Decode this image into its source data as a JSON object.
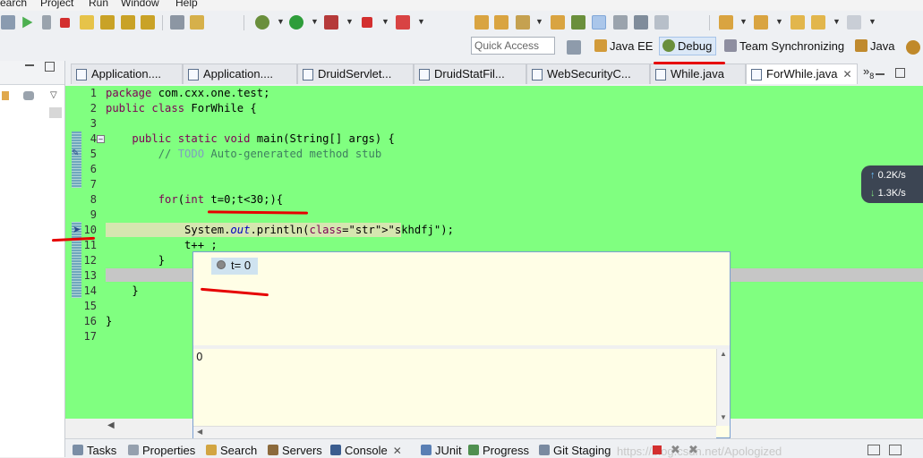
{
  "menu": [
    "earch",
    "Project",
    "Run",
    "Window",
    "Help"
  ],
  "quick_access": {
    "placeholder": "Quick Access"
  },
  "perspectives": [
    {
      "label": "Java EE",
      "active": false
    },
    {
      "label": "Debug",
      "active": true
    },
    {
      "label": "Team Synchronizing",
      "active": false
    },
    {
      "label": "Java",
      "active": false
    }
  ],
  "editor_tabs": [
    {
      "label": "Application....",
      "active": false
    },
    {
      "label": "Application....",
      "active": false
    },
    {
      "label": "DruidServlet...",
      "active": false
    },
    {
      "label": "DruidStatFil...",
      "active": false
    },
    {
      "label": "WebSecurityC...",
      "active": false
    },
    {
      "label": "While.java",
      "active": false
    },
    {
      "label": "ForWhile.java",
      "active": true
    }
  ],
  "tab_overflow": {
    "symbol": "»",
    "count": "8"
  },
  "close_symbol": "✕",
  "code_lines": [
    {
      "n": "1",
      "text": "package com.cxx.one.test;"
    },
    {
      "n": "2",
      "text": "public class ForWhile {"
    },
    {
      "n": "3",
      "text": ""
    },
    {
      "n": "4",
      "text": "    public static void main(String[] args) {"
    },
    {
      "n": "5",
      "text": "        // TODO Auto-generated method stub"
    },
    {
      "n": "6",
      "text": ""
    },
    {
      "n": "7",
      "text": ""
    },
    {
      "n": "8",
      "text": "        for(int t=0;t<30;){"
    },
    {
      "n": "9",
      "text": ""
    },
    {
      "n": "10",
      "text": "            System.out.println(\"skhdfj\");"
    },
    {
      "n": "11",
      "text": "            t++ ;"
    },
    {
      "n": "12",
      "text": "        }"
    },
    {
      "n": "13",
      "text": ""
    },
    {
      "n": "14",
      "text": "    }"
    },
    {
      "n": "15",
      "text": ""
    },
    {
      "n": "16",
      "text": "}"
    },
    {
      "n": "17",
      "text": ""
    }
  ],
  "hover": {
    "variable": "t= 0",
    "value": "0"
  },
  "network": {
    "up": "0.2K/s",
    "down": "1.3K/s",
    "up_arrow": "↑",
    "down_arrow": "↓"
  },
  "bottom_tabs": [
    "Tasks",
    "Properties",
    "Search",
    "Servers",
    "Console",
    "JUnit",
    "Progress",
    "Git Staging"
  ],
  "watermark": "https://blog.csdn.net/Apologized",
  "colors": {
    "editor_bg": "#80ff80",
    "annotation": "#e60000",
    "popup_bg": "#fffee6"
  }
}
